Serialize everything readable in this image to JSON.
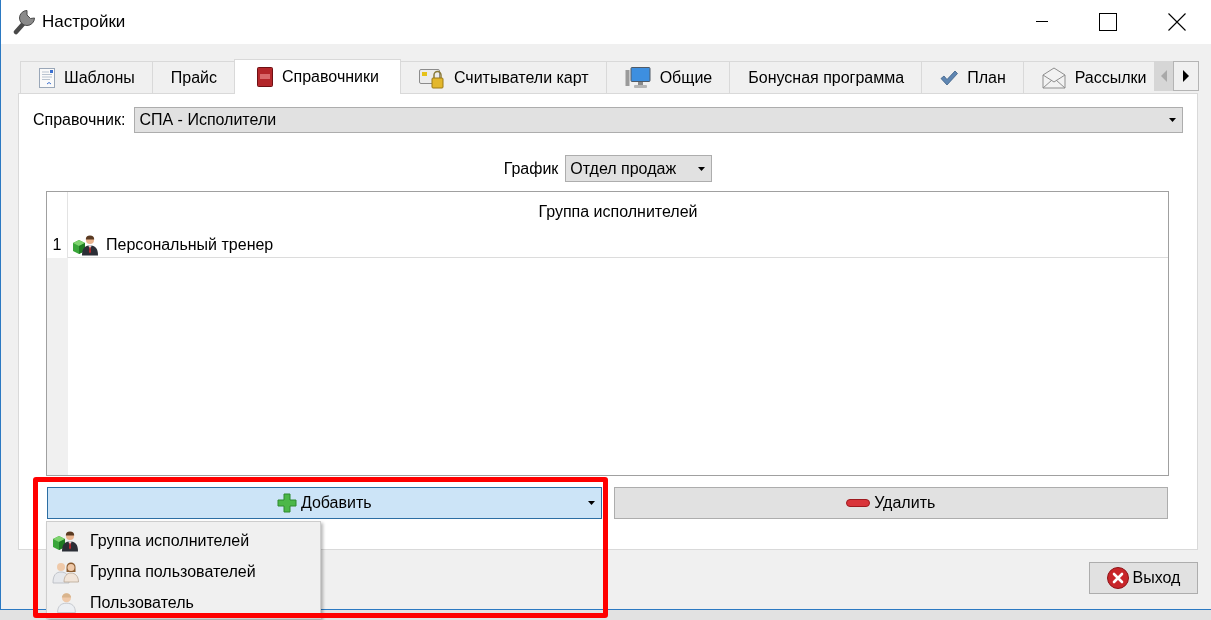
{
  "window": {
    "title": "Настройки"
  },
  "tabs": [
    {
      "label": "Шаблоны",
      "selected": false
    },
    {
      "label": "Прайс",
      "selected": false
    },
    {
      "label": "Справочники",
      "selected": true
    },
    {
      "label": "Считыватели карт",
      "selected": false
    },
    {
      "label": "Общие",
      "selected": false
    },
    {
      "label": "Бонусная программа",
      "selected": false
    },
    {
      "label": "План",
      "selected": false
    },
    {
      "label": "Рассылки",
      "selected": false
    }
  ],
  "tab_scroll_buttons": [
    {
      "disabled": true
    },
    {
      "disabled": false
    }
  ],
  "directory": {
    "label": "Справочник:",
    "value": "СПА - Исполители"
  },
  "schedule": {
    "label": "График",
    "value": "Отдел продаж"
  },
  "table": {
    "columns": [
      "Группа исполнителей"
    ],
    "rows": [
      {
        "number": "1",
        "cells": [
          "Персональный тренер"
        ]
      }
    ]
  },
  "add_button": {
    "label": "Добавить",
    "expanded": true,
    "highlighted": true,
    "menu": [
      {
        "label": "Группа исполнителей"
      },
      {
        "label": "Группа пользователей"
      },
      {
        "label": "Пользователь"
      }
    ]
  },
  "delete_button": {
    "label": "Удалить"
  },
  "exit_button": {
    "label": "Выход"
  }
}
